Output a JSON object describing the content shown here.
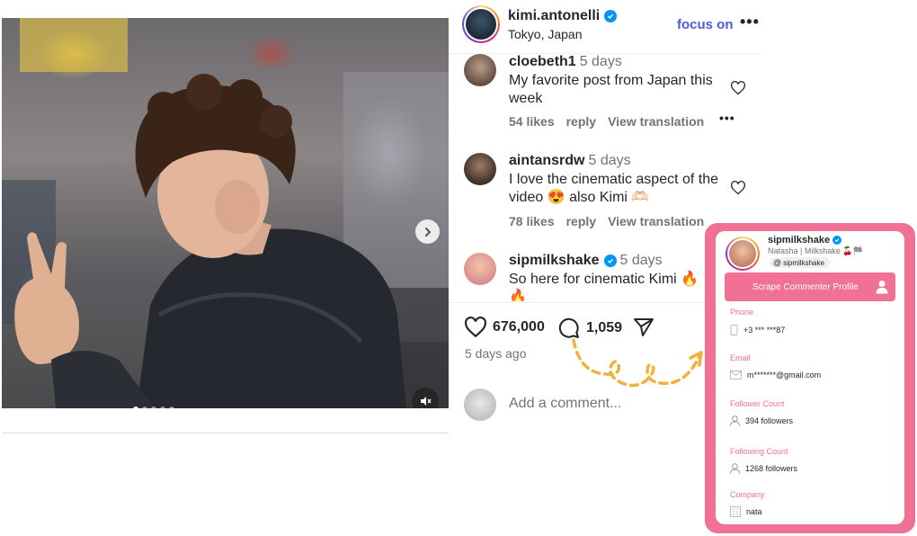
{
  "post": {
    "image_alt": "Photo of a young man making a peace sign in a city street",
    "carousel_dots": 5,
    "active_dot": 0
  },
  "header": {
    "username": "kimi.antonelli",
    "location": "Tokyo, Japan",
    "follow_label": "focus on",
    "more_label": "•••"
  },
  "comments": [
    {
      "username": "cloebeth1",
      "time": "5 days",
      "text": "My favorite post from Japan this week",
      "likes": "54 likes",
      "reply": "reply",
      "translate": "View translation",
      "verified": false
    },
    {
      "username": "aintansrdw",
      "time": "5 days",
      "text": "I love the cinematic aspect of the video 😍 also Kimi 🫶🏻",
      "likes": "78 likes",
      "reply": "reply",
      "translate": "View translation",
      "verified": false
    },
    {
      "username": "sipmilkshake",
      "time": "5 days",
      "text": "So here for cinematic Kimi 🔥🔥",
      "verified": true
    }
  ],
  "actions": {
    "likes": "676,000",
    "comments": "1,059",
    "posted": "5 days ago",
    "add_comment_placeholder": "Add a comment..."
  },
  "panel": {
    "username": "sipmilkshake",
    "subtitle": "Natasha | Milkshake 🍒🏁",
    "handle": "sipmilkshake",
    "scrape_label": "Scrape Commenter Profile",
    "fields": [
      {
        "label": "Phone",
        "value": "+3 *** ***87",
        "icon": "phone-icon"
      },
      {
        "label": "Email",
        "value": "m*******@gmail.com",
        "icon": "mail-icon"
      },
      {
        "label": "Follower Count",
        "value": "394 followers",
        "icon": "user-icon"
      },
      {
        "label": "Following Count",
        "value": "1268 followers",
        "icon": "user-icon"
      },
      {
        "label": "Company",
        "value": "nata",
        "icon": "building-icon"
      }
    ]
  },
  "colors": {
    "accent_pink": "#f07096",
    "follow_blue": "#4f5bd5",
    "verified_blue": "#0095f6"
  }
}
